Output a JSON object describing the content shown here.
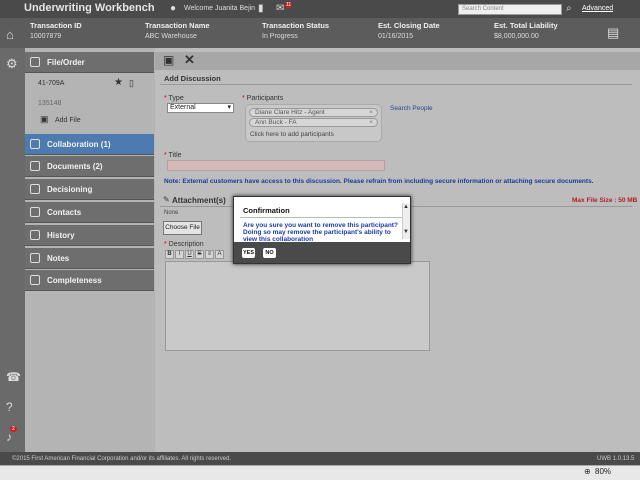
{
  "app": {
    "title": "Underwriting Workbench",
    "welcome": "Welcome Juanita Bejin",
    "notifications_count": "11",
    "search_placeholder": "Search Content",
    "advanced_label": "Advanced"
  },
  "transaction": {
    "headers": [
      "Transaction ID",
      "Transaction Name",
      "Transaction Status",
      "Est. Closing Date",
      "Est. Total Liability"
    ],
    "values": [
      "10007879",
      "ABC Warehouse",
      "In Progress",
      "01/16/2015",
      "$8,000,000.00"
    ]
  },
  "rail": {
    "alert_count": "2"
  },
  "sidebar": {
    "file_order_label": "File/Order",
    "order_number": "41-709A",
    "order_sub": "135148",
    "add_file_label": "Add File",
    "items": [
      {
        "label": "Collaboration (1)",
        "icon": "collaboration-icon"
      },
      {
        "label": "Documents (2)",
        "icon": "documents-icon"
      },
      {
        "label": "Decisioning",
        "icon": "gavel-icon"
      },
      {
        "label": "Contacts",
        "icon": "contacts-icon"
      },
      {
        "label": "History",
        "icon": "history-icon"
      },
      {
        "label": "Notes",
        "icon": "notes-icon"
      },
      {
        "label": "Completeness",
        "icon": "completeness-icon"
      }
    ]
  },
  "form": {
    "section_title": "Add Discussion",
    "type_label": "Type",
    "type_value": "External",
    "participants_label": "Participants",
    "participants": [
      "Diane Clare Hitz - Agent",
      "Ann Buck - FA"
    ],
    "click_to_add": "Click here to add participants",
    "search_people": "Search People",
    "title_label": "Title",
    "note": "Note: External customers have access to this discussion. Please refrain from including secure information or attaching secure documents.",
    "attachments_label": "Attachment(s)",
    "max_file_size": "Max File Size : 50 MB",
    "none_label": "None",
    "choose_file": "Choose File",
    "description_label": "Description",
    "editor_buttons": [
      "B",
      "I",
      "U",
      "S",
      "≡",
      "A"
    ]
  },
  "dialog": {
    "title": "Confirmation",
    "message": "Are you sure you want to remove this participant? Doing so may remove the participant's ability to view this collaboration",
    "yes": "YES",
    "no": "NO"
  },
  "footer": {
    "copyright": "©2015 First American Financial Corporation and/or its affiliates. All rights reserved.",
    "version": "UWB 1.0.13.5",
    "zoom": "80%"
  },
  "colors": {
    "accent": "#4d7bb0",
    "dialog_text": "#1a3aa8",
    "note_text": "#1a3a9a",
    "warning": "#b02020"
  }
}
